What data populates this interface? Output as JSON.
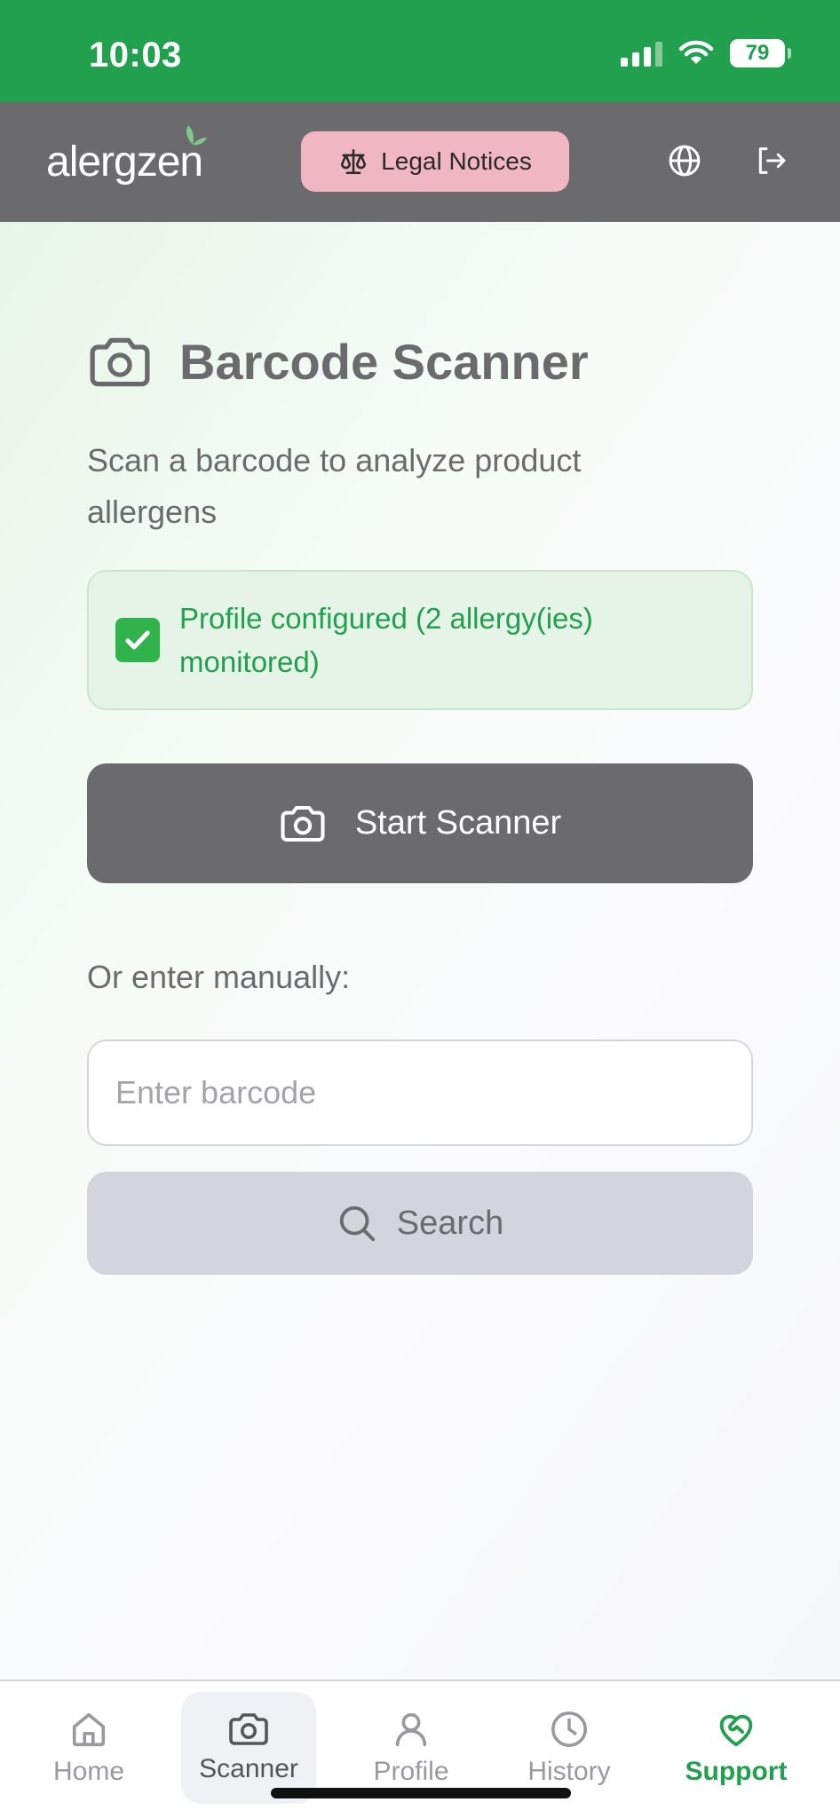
{
  "status_bar": {
    "time": "10:03",
    "battery": "79"
  },
  "header": {
    "logo": "alergzen",
    "legal_label": "Legal Notices",
    "icons": [
      "globe-icon",
      "logout-icon",
      "scale-icon"
    ]
  },
  "main": {
    "title": "Barcode Scanner",
    "subtitle": "Scan a barcode to analyze product allergens",
    "profile_status": "Profile configured (2 allergy(ies) monitored)",
    "start_scanner_label": "Start Scanner",
    "manual_label": "Or enter manually:",
    "barcode_placeholder": "Enter barcode",
    "search_label": "Search"
  },
  "nav": {
    "items": [
      {
        "label": "Home",
        "icon": "home-icon"
      },
      {
        "label": "Scanner",
        "icon": "camera-icon"
      },
      {
        "label": "Profile",
        "icon": "user-icon"
      },
      {
        "label": "History",
        "icon": "clock-icon"
      },
      {
        "label": "Support",
        "icon": "heart-handshake-icon"
      }
    ],
    "active": "Scanner"
  },
  "colors": {
    "brand_green": "#21a04e",
    "header_gray": "#6b6b6e",
    "legal_pink": "#f0b6c3",
    "disabled_button": "#d3d4dc"
  }
}
